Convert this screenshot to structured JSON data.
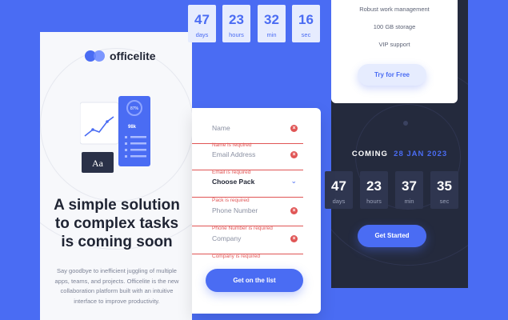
{
  "brand": {
    "name": "officelite"
  },
  "hero": {
    "headline": "A simple solution to complex tasks is coming soon",
    "description": "Say goodbye to inefficient juggling of multiple apps, teams, and projects. Officelite is the new collaboration platform built with an intuitive interface to improve productivity.",
    "illustration": {
      "card_text": "Aa",
      "percent_text": "87%",
      "big_number": "98k"
    }
  },
  "countdown_top": [
    {
      "value": "47",
      "label": "days"
    },
    {
      "value": "23",
      "label": "hours"
    },
    {
      "value": "32",
      "label": "min"
    },
    {
      "value": "16",
      "label": "sec"
    }
  ],
  "pricing": {
    "features": [
      "Robust work management",
      "100 GB storage",
      "VIP support"
    ],
    "button": "Try for Free"
  },
  "coming": {
    "prefix": "COMING",
    "date": "28 JAN 2023"
  },
  "countdown_bottom": [
    {
      "value": "47",
      "label": "days"
    },
    {
      "value": "23",
      "label": "hours"
    },
    {
      "value": "37",
      "label": "min"
    },
    {
      "value": "35",
      "label": "sec"
    }
  ],
  "cta": {
    "get_started": "Get Started"
  },
  "form": {
    "fields": [
      {
        "placeholder": "Name",
        "error": "Name is required"
      },
      {
        "placeholder": "Email Address",
        "error": "Email is required"
      },
      {
        "placeholder": "Choose Pack",
        "error": "Pack is required"
      },
      {
        "placeholder": "Phone Number",
        "error": "Phone Number is required"
      },
      {
        "placeholder": "Company",
        "error": "Company is required"
      }
    ],
    "submit": "Get on the list"
  },
  "colors": {
    "accent": "#4a6cf3",
    "dark": "#242a3d",
    "error": "#e05555"
  },
  "icons": [
    "error-icon",
    "chevron-down-icon"
  ]
}
